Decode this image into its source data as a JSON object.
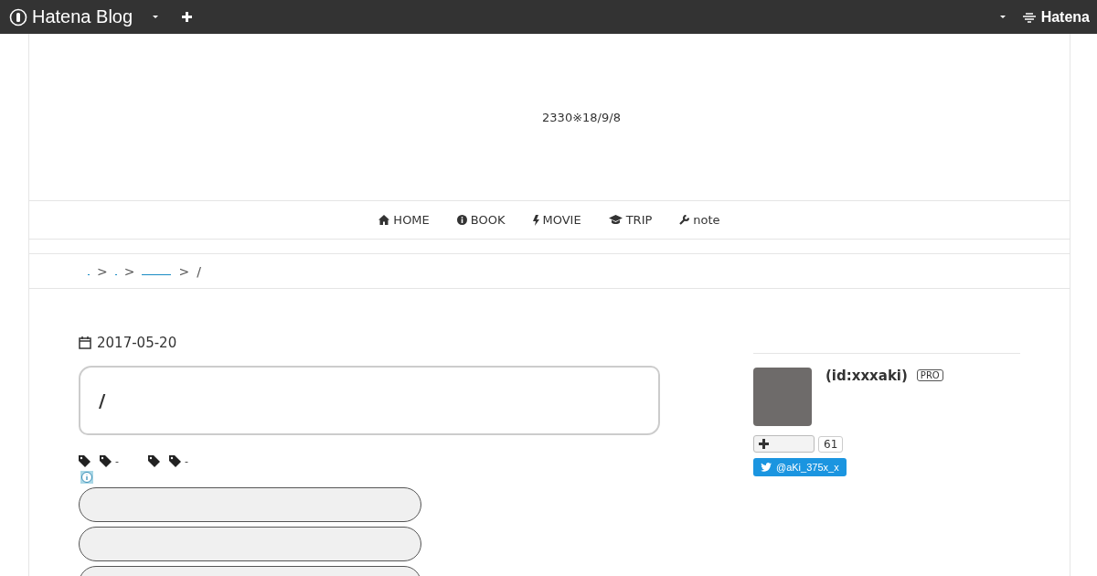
{
  "topbar": {
    "brand": "Hatena Blog",
    "right_brand": "Hatena"
  },
  "header": {
    "description": "2330※18/9/8"
  },
  "nav": [
    {
      "label": "HOME"
    },
    {
      "label": "BOOK"
    },
    {
      "label": "MOVIE"
    },
    {
      "label": "TRIP"
    },
    {
      "label": "note"
    }
  ],
  "breadcrumb": {
    "links": [
      {
        "kind": "dot"
      },
      {
        "kind": "dot"
      },
      {
        "kind": "line"
      }
    ],
    "separator": ">",
    "current": "/"
  },
  "entry": {
    "date": "2017-05-20",
    "title": "/",
    "tag_groups": [
      {
        "label": "-"
      },
      {
        "label": "-"
      }
    ],
    "share_buttons": [
      {
        "kind": "pill"
      },
      {
        "kind": "pill"
      },
      {
        "kind": "pill"
      }
    ]
  },
  "sidebar": {
    "profile": {
      "id": "(id:xxxaki)",
      "badge": "PRO",
      "subscribe_count": "61",
      "twitter": "@aKi_375x_x"
    }
  }
}
